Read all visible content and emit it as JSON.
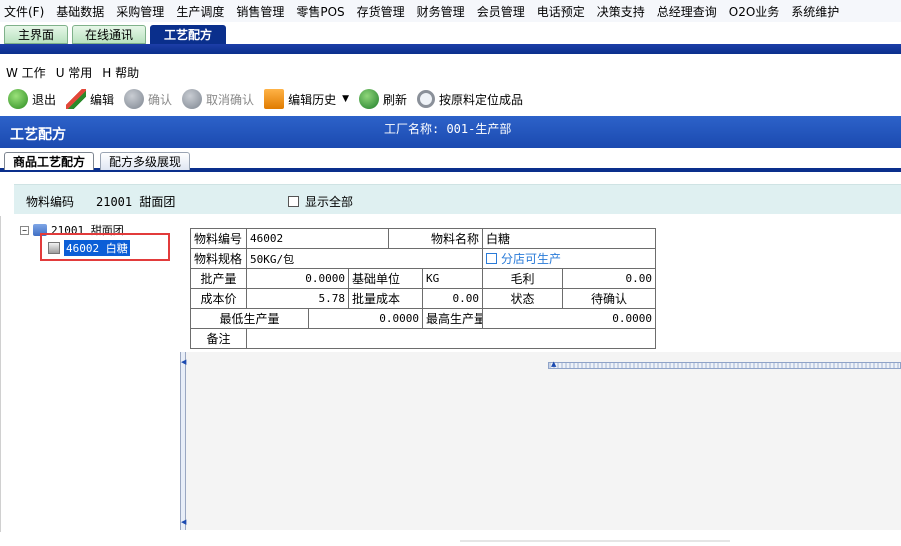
{
  "menubar": {
    "items": [
      "文件(F)",
      "基础数据",
      "采购管理",
      "生产调度",
      "销售管理",
      "零售POS",
      "存货管理",
      "财务管理",
      "会员管理",
      "电话预定",
      "决策支持",
      "总经理查询",
      "O2O业务",
      "系统维护"
    ]
  },
  "tabs": {
    "main": "主界面",
    "online": "在线通讯",
    "recipe": "工艺配方"
  },
  "submenu": {
    "work": "W 工作",
    "common": "U 常用",
    "help": "H 帮助"
  },
  "toolbar": {
    "exit": "退出",
    "edit": "编辑",
    "confirm": "确认",
    "cancel_confirm": "取消确认",
    "edit_history": "编辑历史",
    "refresh": "刷新",
    "locate": "按原料定位成品"
  },
  "header": {
    "title": "工艺配方",
    "factory": "工厂名称: 001-生产部"
  },
  "inner_tabs": {
    "product_recipe": "商品工艺配方",
    "multi_level": "配方多级展现"
  },
  "filter": {
    "code_label": "物料编码",
    "code_value": "21001 甜面团",
    "show_all": "显示全部"
  },
  "tree": {
    "root": "21001 甜面团",
    "child": "46002 白糖"
  },
  "detail": {
    "material_code_label": "物料编号",
    "material_code": "46002",
    "material_name_label": "物料名称",
    "material_name": "白糖",
    "spec_label": "物料规格",
    "spec": "50KG/包",
    "store_produce": "分店可生产",
    "batch_qty_label": "批产量",
    "batch_qty": "0.0000",
    "base_unit_label": "基础单位",
    "base_unit": "KG",
    "gross_profit_label": "毛利",
    "gross_profit": "0.00",
    "cost_price_label": "成本价",
    "cost_price": "5.78",
    "batch_cost_label": "批量成本",
    "batch_cost": "0.00",
    "status_label": "状态",
    "status": "待确认",
    "min_prod_label": "最低生产量",
    "min_prod": "0.0000",
    "max_prod_label": "最高生产量",
    "max_prod": "0.0000",
    "remark_label": "备注",
    "remark": ""
  }
}
